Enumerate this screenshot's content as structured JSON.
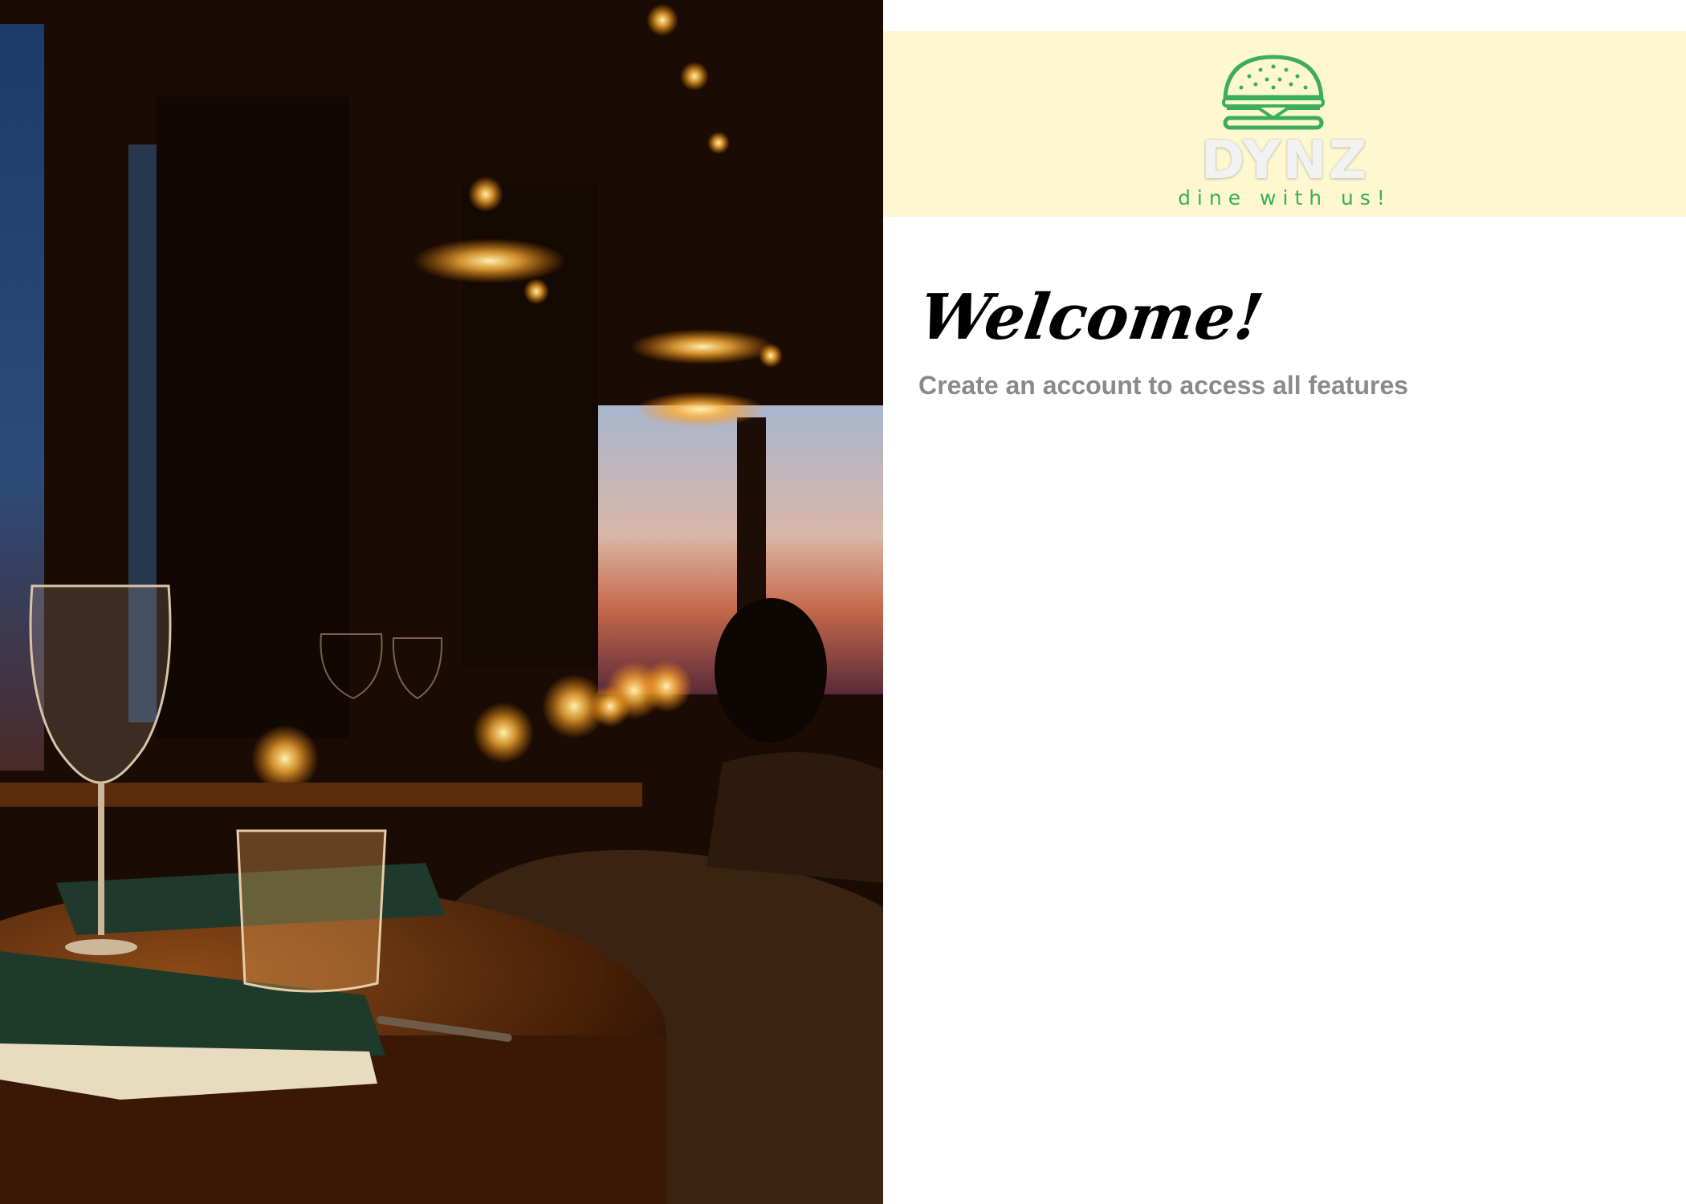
{
  "brand": {
    "name": "DYNZ",
    "tagline": "dine with us!",
    "logo_icon": "burger-icon",
    "accent_color": "#3cae5a",
    "bar_color": "#fef7cf"
  },
  "content": {
    "heading": "Welcome!",
    "subheading": "Create an account to access all features"
  },
  "hero": {
    "image": "restaurant-interior-photo"
  }
}
